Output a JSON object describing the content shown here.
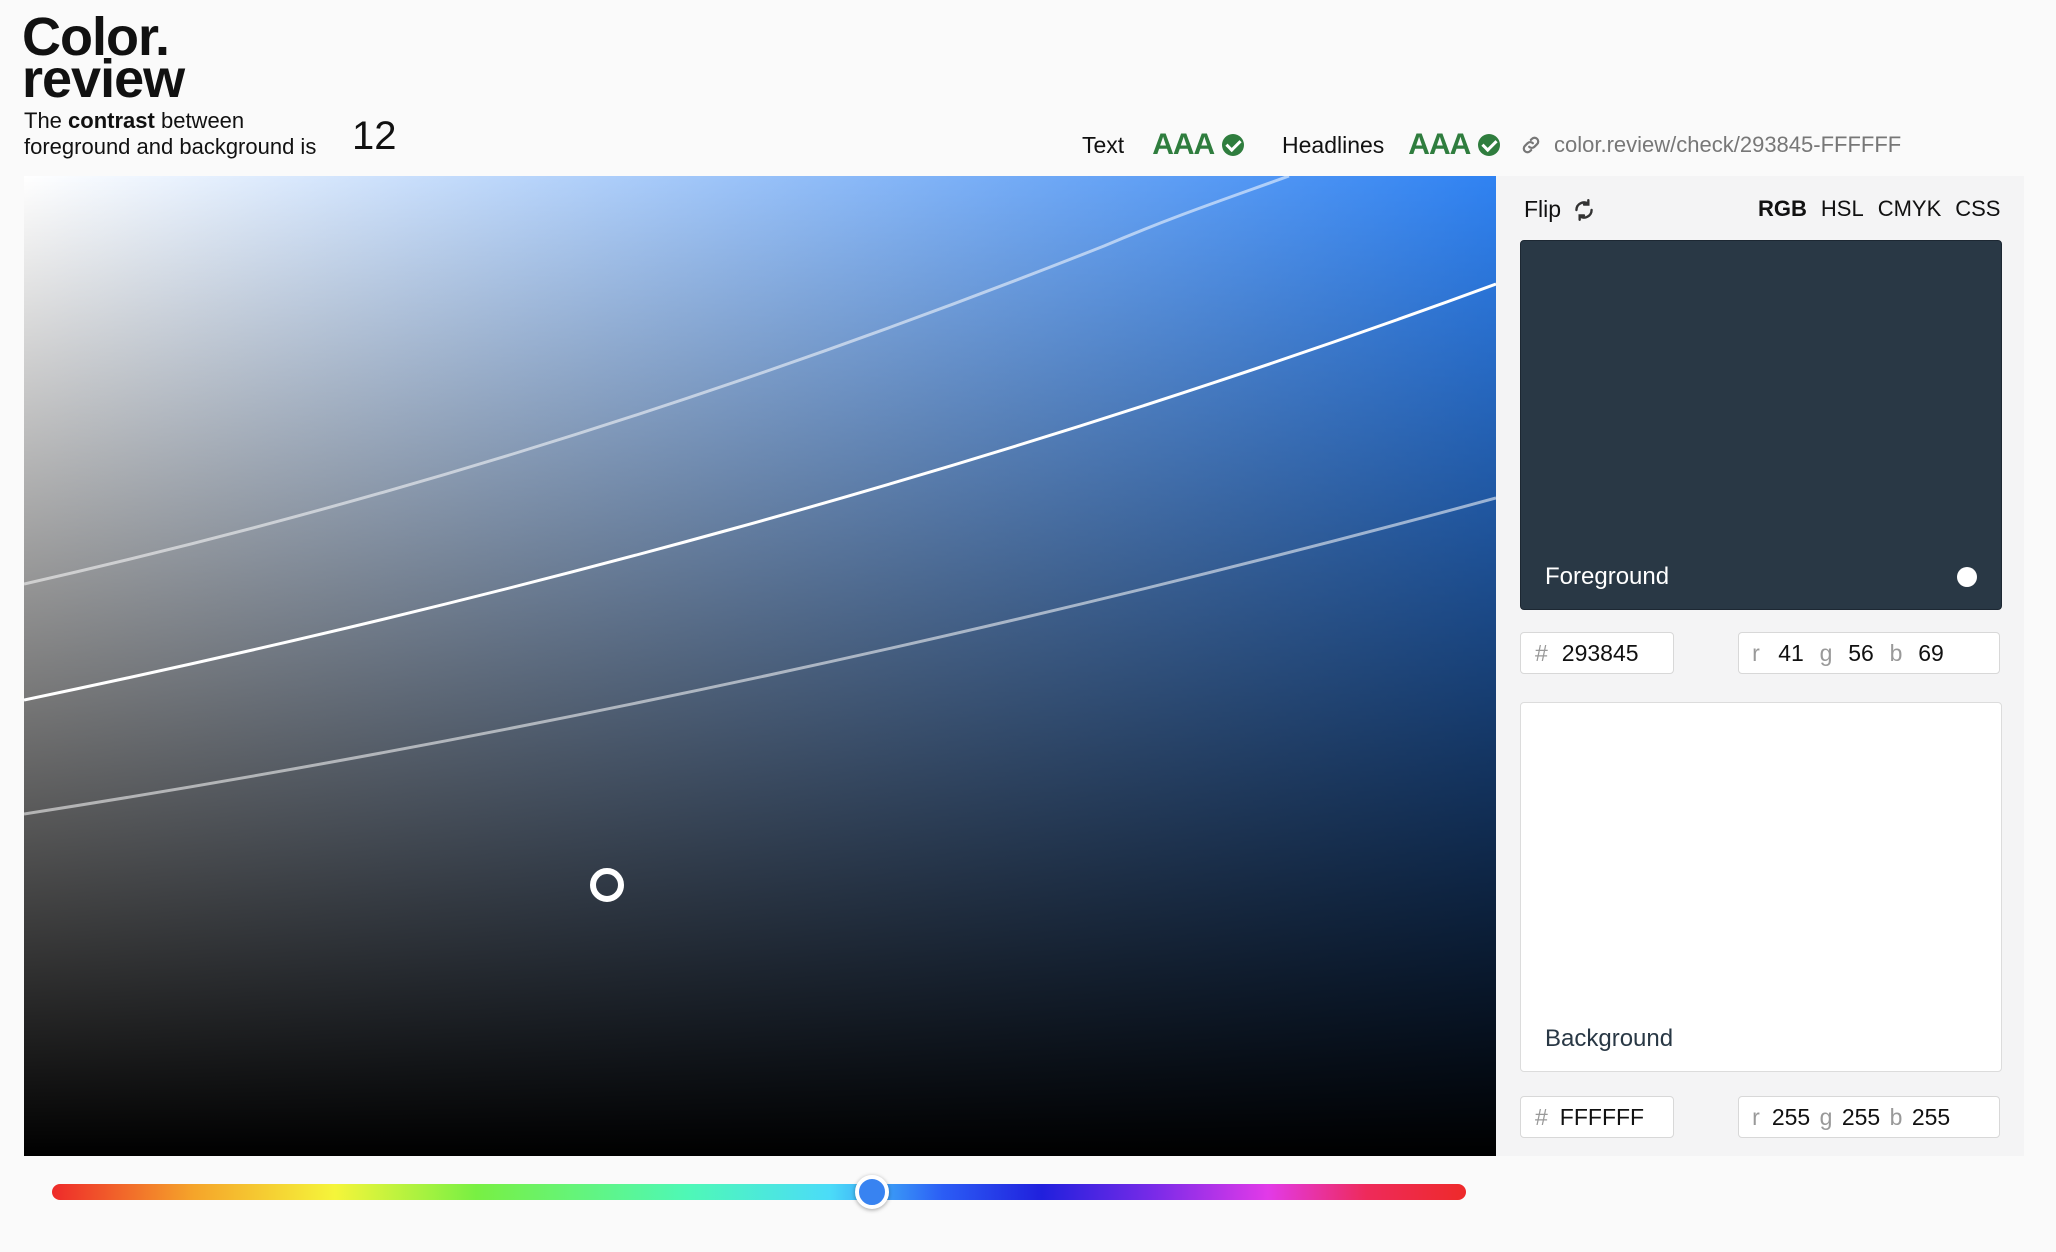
{
  "logo": {
    "line1": "Color.",
    "line2": "review"
  },
  "contrast": {
    "prefix": "The",
    "emphasis": "contrast",
    "suffix": "between",
    "line2": "foreground and background is",
    "value": "12"
  },
  "ratings": [
    {
      "label": "Text",
      "badge": "AAA"
    },
    {
      "label": "Headlines",
      "badge": "AAA"
    }
  ],
  "share": {
    "url": "color.review/check/293845-FFFFFF",
    "icon": "link-icon"
  },
  "panel": {
    "flip_label": "Flip",
    "flip_icon": "flip-icon",
    "formats": [
      "RGB",
      "HSL",
      "CMYK",
      "CSS"
    ],
    "active_format": "RGB"
  },
  "foreground": {
    "label": "Foreground",
    "color": "#293845",
    "hex_prefix": "#",
    "hex": "293845",
    "rgb": {
      "r_label": "r",
      "r": "41",
      "g_label": "g",
      "g": "56",
      "b_label": "b",
      "b": "69"
    }
  },
  "background": {
    "label": "Background",
    "color": "#FFFFFF",
    "hex_prefix": "#",
    "hex": "FFFFFF",
    "rgb": {
      "r_label": "r",
      "r": "255",
      "g_label": "g",
      "g": "255",
      "b_label": "b",
      "b": "255"
    }
  },
  "hue_slider": {
    "hue_degrees": 215,
    "fraction": 0.58
  },
  "colors": {
    "pass_green": "#2f7d3e",
    "accent_blue": "#3883f1"
  }
}
